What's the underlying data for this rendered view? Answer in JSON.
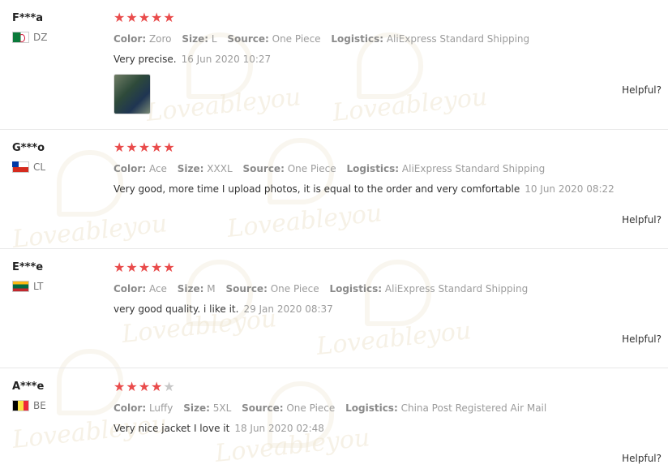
{
  "watermark": {
    "brand": "Loveableyou"
  },
  "colors": {
    "star_on": "#e94b4b",
    "star_off": "#c8c8c8"
  },
  "labels": {
    "color": "Color:",
    "size": "Size:",
    "source": "Source:",
    "logistics": "Logistics:",
    "helpful": "Helpful?"
  },
  "reviews": [
    {
      "user": "F***a",
      "country": "DZ",
      "rating": 5,
      "color": "Zoro",
      "size": "L",
      "source": "One Piece",
      "logistics": "AliExpress Standard Shipping",
      "text": "Very precise.",
      "date": "16 Jun 2020 10:27",
      "has_photo": true
    },
    {
      "user": "G***o",
      "country": "CL",
      "rating": 5,
      "color": "Ace",
      "size": "XXXL",
      "source": "One Piece",
      "logistics": "AliExpress Standard Shipping",
      "text": "Very good, more time I upload photos, it is equal to the order and very comfortable",
      "date": "10 Jun 2020 08:22",
      "has_photo": false
    },
    {
      "user": "E***e",
      "country": "LT",
      "rating": 5,
      "color": "Ace",
      "size": "M",
      "source": "One Piece",
      "logistics": "AliExpress Standard Shipping",
      "text": "very good quality. i like it.",
      "date": "29 Jan 2020 08:37",
      "has_photo": false
    },
    {
      "user": "A***e",
      "country": "BE",
      "rating": 4,
      "color": "Luffy",
      "size": "5XL",
      "source": "One Piece",
      "logistics": "China Post Registered Air Mail",
      "text": "Very nice jacket I love it",
      "date": "18 Jun 2020 02:48",
      "has_photo": false
    }
  ]
}
